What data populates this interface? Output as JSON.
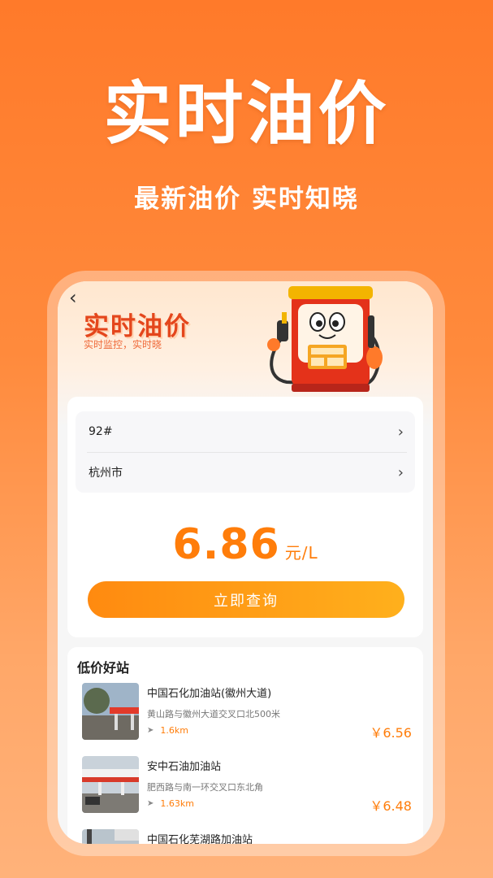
{
  "banner": {
    "title": "实时油价",
    "subtitle": "最新油价 实时知晓"
  },
  "app": {
    "back_label": "‹",
    "header_title": "实时油价",
    "header_subtitle": "实时监控，实时晓",
    "fuel_type": "92#",
    "city": "杭州市",
    "price": "6.86",
    "price_unit": "元/L",
    "query_button": "立即查询",
    "stations_title": "低价好站",
    "stations": [
      {
        "name": "中国石化加油站(徽州大道)",
        "address": "黄山路与徽州大道交叉口北500米",
        "distance": "1.6km",
        "price": "￥6.56"
      },
      {
        "name": "安中石油加油站",
        "address": "肥西路与南一环交叉口东北角",
        "distance": "1.63km",
        "price": "￥6.48"
      },
      {
        "name": "中国石化芜湖路加油站",
        "address": "",
        "distance": "",
        "price": ""
      }
    ]
  },
  "colors": {
    "accent": "#ff7d0a",
    "header_title": "#e4461c",
    "background_top": "#ff7a2a",
    "background_bottom": "#ffb27a"
  },
  "icons": {
    "back": "back-arrow-icon",
    "chevron": "chevron-right-icon",
    "navigation": "navigation-arrow-icon",
    "pump": "fuel-pump-mascot-icon"
  }
}
